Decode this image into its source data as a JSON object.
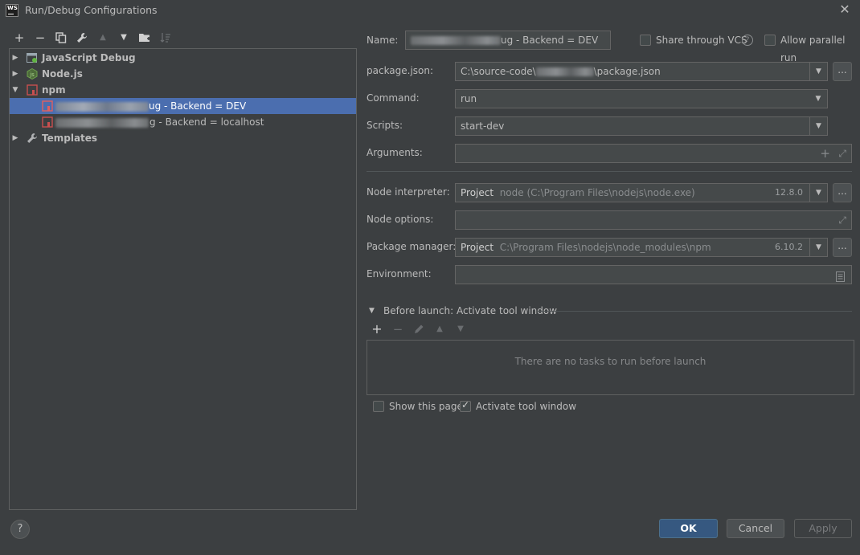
{
  "window": {
    "title": "Run/Debug Configurations",
    "logo_text": "WS"
  },
  "toolbar": {
    "add": "+",
    "remove": "−",
    "copy": "⧉",
    "edit": "🔧",
    "up": "▲",
    "down": "▼",
    "folder": "▰",
    "sort": "↓≡"
  },
  "tree": {
    "items": [
      {
        "label": "JavaScript Debug",
        "icon": "javascript-debug-icon"
      },
      {
        "label": "Node.js",
        "icon": "nodejs-icon"
      },
      {
        "label": "npm",
        "icon": "npm-icon"
      },
      {
        "label": "ug - Backend = DEV",
        "icon": "npm-config-icon"
      },
      {
        "label": "g - Backend = localhost",
        "icon": "npm-config-icon"
      },
      {
        "label": "Templates",
        "icon": "wrench-icon"
      }
    ]
  },
  "form": {
    "name_label": "Name:",
    "name_value": "ug - Backend = DEV",
    "share_vcs": "Share through VCS",
    "allow_parallel": "Allow parallel run",
    "package_json_label": "package.json:",
    "package_json_prefix": "C:\\source-code\\",
    "package_json_suffix": "\\package.json",
    "command_label": "Command:",
    "command_value": "run",
    "scripts_label": "Scripts:",
    "scripts_value": "start-dev",
    "arguments_label": "Arguments:",
    "node_interpreter_label": "Node interpreter:",
    "node_interpreter_kind": "Project",
    "node_interpreter_path": "node (C:\\Program Files\\nodejs\\node.exe)",
    "node_interpreter_version": "12.8.0",
    "node_options_label": "Node options:",
    "package_manager_label": "Package manager:",
    "package_manager_kind": "Project",
    "package_manager_path": "C:\\Program Files\\nodejs\\node_modules\\npm",
    "package_manager_version": "6.10.2",
    "environment_label": "Environment:",
    "dots": "..."
  },
  "before_launch": {
    "title": "Before launch: Activate tool window",
    "empty_message": "There are no tasks to run before launch",
    "show_page": "Show this page",
    "activate_window": "Activate tool window"
  },
  "buttons": {
    "ok": "OK",
    "cancel": "Cancel",
    "apply": "Apply",
    "help": "?"
  }
}
